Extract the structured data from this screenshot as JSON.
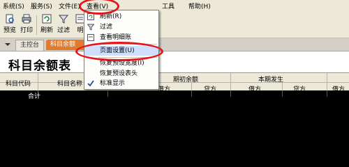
{
  "menubar": {
    "items": [
      {
        "label": "系统(S)"
      },
      {
        "label": "服务(S)"
      },
      {
        "label": "文件(E)"
      },
      {
        "label": "查看(V)"
      },
      {
        "label": "工具"
      },
      {
        "label": "帮助(H)"
      }
    ]
  },
  "toolbar": {
    "buttons": [
      {
        "label": "预览",
        "icon": "preview-icon"
      },
      {
        "label": "打印",
        "icon": "printer-icon"
      },
      {
        "label": "刷新",
        "icon": "refresh-icon"
      },
      {
        "label": "过滤",
        "icon": "filter-icon"
      },
      {
        "label": "明",
        "icon": "detail-icon"
      }
    ]
  },
  "tabs": {
    "home": "主控台",
    "active": "科目余额"
  },
  "view_menu": {
    "items": [
      {
        "label": "刷新(R)",
        "icon": "refresh-icon"
      },
      {
        "label": "过滤",
        "icon": "filter-icon"
      },
      {
        "label": "查看明细账",
        "icon": "detail-icon"
      },
      {
        "label": "页面设置(U)",
        "icon": ""
      },
      {
        "label": "恢复预设宽度(I)",
        "icon": ""
      },
      {
        "label": "恢复预设表头",
        "icon": ""
      },
      {
        "label": "标准显示",
        "icon": "checkmark-icon"
      }
    ]
  },
  "report": {
    "title": "科目余额表",
    "col_code": "科目代码",
    "col_name": "科目名称",
    "group_opening": "期初余额",
    "group_current": "本期发生",
    "debit": "借方",
    "credit": "贷方",
    "sum_row": "合计"
  },
  "colors": {
    "menubar_bg": "#ece9d8",
    "tab_active": "#e07a2c",
    "highlight_oval": "#e3161b",
    "grid_body": "#000000"
  }
}
